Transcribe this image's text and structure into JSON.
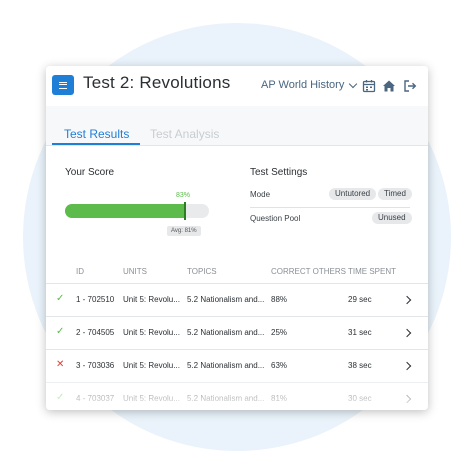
{
  "header": {
    "title": "Test 2: Revolutions",
    "subject": "AP World History",
    "icons": [
      "menu-icon",
      "calendar-icon",
      "home-icon",
      "logout-icon"
    ]
  },
  "tabs": [
    {
      "label": "Test Results",
      "active": true
    },
    {
      "label": "Test Analysis",
      "active": false
    }
  ],
  "score": {
    "title": "Your Score",
    "value_percent": 83,
    "value_label": "83%",
    "avg_percent": 81,
    "avg_label": "Avg: 81%"
  },
  "settings": {
    "title": "Test Settings",
    "mode_label": "Mode",
    "mode_options": [
      "Untutored",
      "Timed"
    ],
    "pool_label": "Question Pool",
    "pool_value": "Unused"
  },
  "table": {
    "headers": [
      "ID",
      "UNITS",
      "TOPICS",
      "CORRECT OTHERS",
      "TIME SPENT"
    ],
    "rows": [
      {
        "status": "correct",
        "mark": "✓",
        "id": "1 - 702510",
        "unit": "Unit 5: Revolu...",
        "topic": "5.2 Nationalism and...",
        "correct_others": "88%",
        "time": "29 sec"
      },
      {
        "status": "correct",
        "mark": "✓",
        "id": "2 - 704505",
        "unit": "Unit 5: Revolu...",
        "topic": "5.2 Nationalism and...",
        "correct_others": "25%",
        "time": "31 sec"
      },
      {
        "status": "incorrect",
        "mark": "✕",
        "id": "3 - 703036",
        "unit": "Unit 5: Revolu...",
        "topic": "5.2 Nationalism and...",
        "correct_others": "63%",
        "time": "38 sec"
      },
      {
        "status": "correct",
        "mark": "✓",
        "id": "4 - 703037",
        "unit": "Unit 5: Revolu...",
        "topic": "5.2 Nationalism and...",
        "correct_others": "81%",
        "time": "30 sec"
      }
    ]
  },
  "colors": {
    "brand": "#1f7fd6",
    "score_fill": "#5cbb4a",
    "correct": "#5cbb4a",
    "incorrect": "#e0403a"
  }
}
